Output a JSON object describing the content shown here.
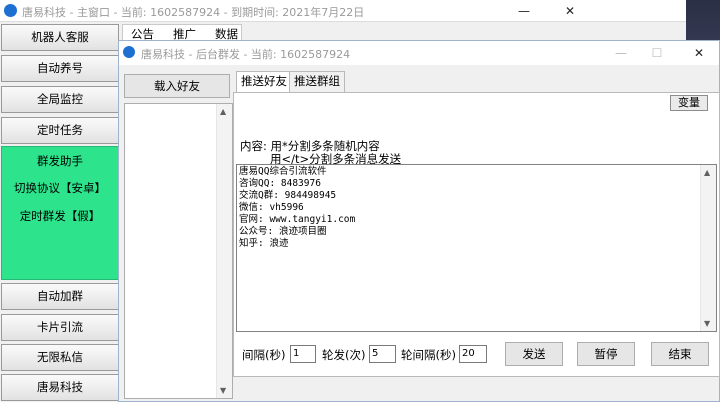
{
  "main_window": {
    "title": "唐易科技 - 主窗口 - 当前: 1602587924 - 到期时间: 2021年7月22日",
    "tabs": [
      "公告",
      "推广",
      "数据"
    ]
  },
  "sidebar": {
    "buttons": [
      "机器人客服",
      "自动养号",
      "全局监控",
      "定时任务"
    ],
    "green_items": [
      "群发助手",
      "切换协议【安卓】",
      "定时群发【假】"
    ],
    "buttons_bottom": [
      "自动加群",
      "卡片引流",
      "无限私信",
      "唐易科技"
    ]
  },
  "sub_window": {
    "title": "唐易科技 - 后台群发 - 当前: 1602587924",
    "load_friends_label": "载入好友",
    "tabs": [
      "推送好友",
      "推送群组"
    ],
    "variable_label": "变量",
    "content_hint_line1": "内容: 用*分割多条随机内容",
    "content_hint_line2": "用</t>分割多条消息发送",
    "content_text": "唐易QQ综合引流软件\n咨询QQ: 8483976\n交流Q群: 984498945\n微信: vh5996\n官网: www.tangyi1.com\n公众号: 浪迹项目圈\n知乎: 浪迹",
    "interval_label": "间隔(秒)",
    "interval_value": "1",
    "rounds_label": "轮发(次)",
    "rounds_value": "5",
    "round_interval_label": "轮间隔(秒)",
    "round_interval_value": "20",
    "send_label": "发送",
    "pause_label": "暂停",
    "end_label": "结束"
  },
  "colors": {
    "green_panel": "#2de38c",
    "title_text": "#9a9a9a"
  }
}
